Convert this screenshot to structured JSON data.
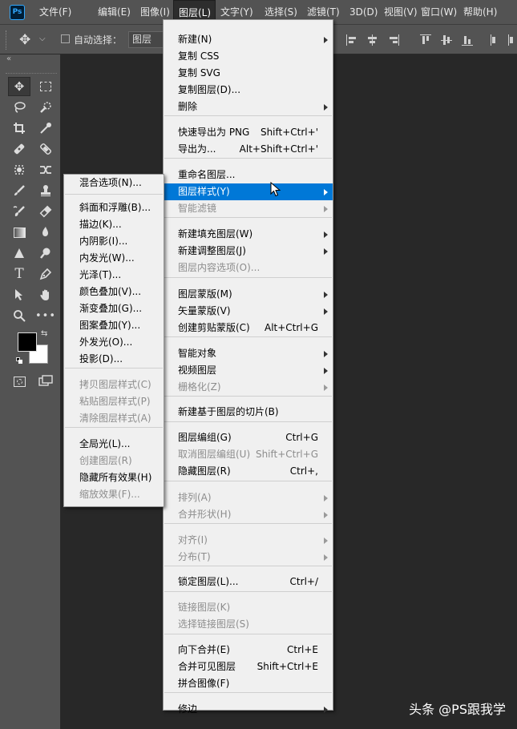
{
  "app": {
    "logo_text": "Ps"
  },
  "menubar": {
    "items": [
      "文件(F)",
      "编辑(E)",
      "图像(I)",
      "图层(L)",
      "文字(Y)",
      "选择(S)",
      "滤镜(T)",
      "3D(D)",
      "视图(V)",
      "窗口(W)",
      "帮助(H)"
    ],
    "active_index": 3
  },
  "optionsbar": {
    "auto_select_label": "自动选择：",
    "auto_select_checked": false,
    "auto_select_value": "图层"
  },
  "layer_menu": {
    "items": [
      {
        "label": "新建(N)",
        "submenu": true
      },
      {
        "label": "复制 CSS"
      },
      {
        "label": "复制 SVG"
      },
      {
        "label": "复制图层(D)..."
      },
      {
        "label": "删除",
        "submenu": true
      },
      {
        "label": "快速导出为 PNG",
        "shortcut": "Shift+Ctrl+'"
      },
      {
        "label": "导出为...",
        "shortcut": "Alt+Shift+Ctrl+'"
      },
      {
        "label": "重命名图层..."
      },
      {
        "label": "图层样式(Y)",
        "submenu": true,
        "highlighted": true
      },
      {
        "label": "智能滤镜",
        "submenu": true,
        "disabled": true
      },
      {
        "label": "新建填充图层(W)",
        "submenu": true
      },
      {
        "label": "新建调整图层(J)",
        "submenu": true
      },
      {
        "label": "图层内容选项(O)...",
        "disabled": true
      },
      {
        "label": "图层蒙版(M)",
        "submenu": true
      },
      {
        "label": "矢量蒙版(V)",
        "submenu": true
      },
      {
        "label": "创建剪贴蒙版(C)",
        "shortcut": "Alt+Ctrl+G"
      },
      {
        "label": "智能对象",
        "submenu": true
      },
      {
        "label": "视频图层",
        "submenu": true
      },
      {
        "label": "栅格化(Z)",
        "submenu": true,
        "disabled": true
      },
      {
        "label": "新建基于图层的切片(B)"
      },
      {
        "label": "图层编组(G)",
        "shortcut": "Ctrl+G"
      },
      {
        "label": "取消图层编组(U)",
        "shortcut": "Shift+Ctrl+G",
        "disabled": true
      },
      {
        "label": "隐藏图层(R)",
        "shortcut": "Ctrl+,"
      },
      {
        "label": "排列(A)",
        "submenu": true,
        "disabled": true
      },
      {
        "label": "合并形状(H)",
        "submenu": true,
        "disabled": true
      },
      {
        "label": "对齐(I)",
        "submenu": true,
        "disabled": true
      },
      {
        "label": "分布(T)",
        "submenu": true,
        "disabled": true
      },
      {
        "label": "锁定图层(L)...",
        "shortcut": "Ctrl+/"
      },
      {
        "label": "链接图层(K)",
        "disabled": true
      },
      {
        "label": "选择链接图层(S)",
        "disabled": true
      },
      {
        "label": "向下合并(E)",
        "shortcut": "Ctrl+E"
      },
      {
        "label": "合并可见图层",
        "shortcut": "Shift+Ctrl+E"
      },
      {
        "label": "拼合图像(F)"
      },
      {
        "label": "修边",
        "submenu": true
      }
    ]
  },
  "style_menu": {
    "items": [
      {
        "label": "混合选项(N)..."
      },
      {
        "label": "斜面和浮雕(B)..."
      },
      {
        "label": "描边(K)..."
      },
      {
        "label": "内阴影(I)..."
      },
      {
        "label": "内发光(W)..."
      },
      {
        "label": "光泽(T)..."
      },
      {
        "label": "颜色叠加(V)..."
      },
      {
        "label": "渐变叠加(G)..."
      },
      {
        "label": "图案叠加(Y)..."
      },
      {
        "label": "外发光(O)..."
      },
      {
        "label": "投影(D)..."
      },
      {
        "label": "拷贝图层样式(C)",
        "disabled": true
      },
      {
        "label": "粘贴图层样式(P)",
        "disabled": true
      },
      {
        "label": "清除图层样式(A)",
        "disabled": true
      },
      {
        "label": "全局光(L)..."
      },
      {
        "label": "创建图层(R)",
        "disabled": true
      },
      {
        "label": "隐藏所有效果(H)"
      },
      {
        "label": "缩放效果(F)...",
        "disabled": true
      }
    ]
  },
  "colors": {
    "foreground": "#000000",
    "background": "#ffffff",
    "highlight": "#0078d7"
  },
  "watermark": "头条 @PS跟我学"
}
